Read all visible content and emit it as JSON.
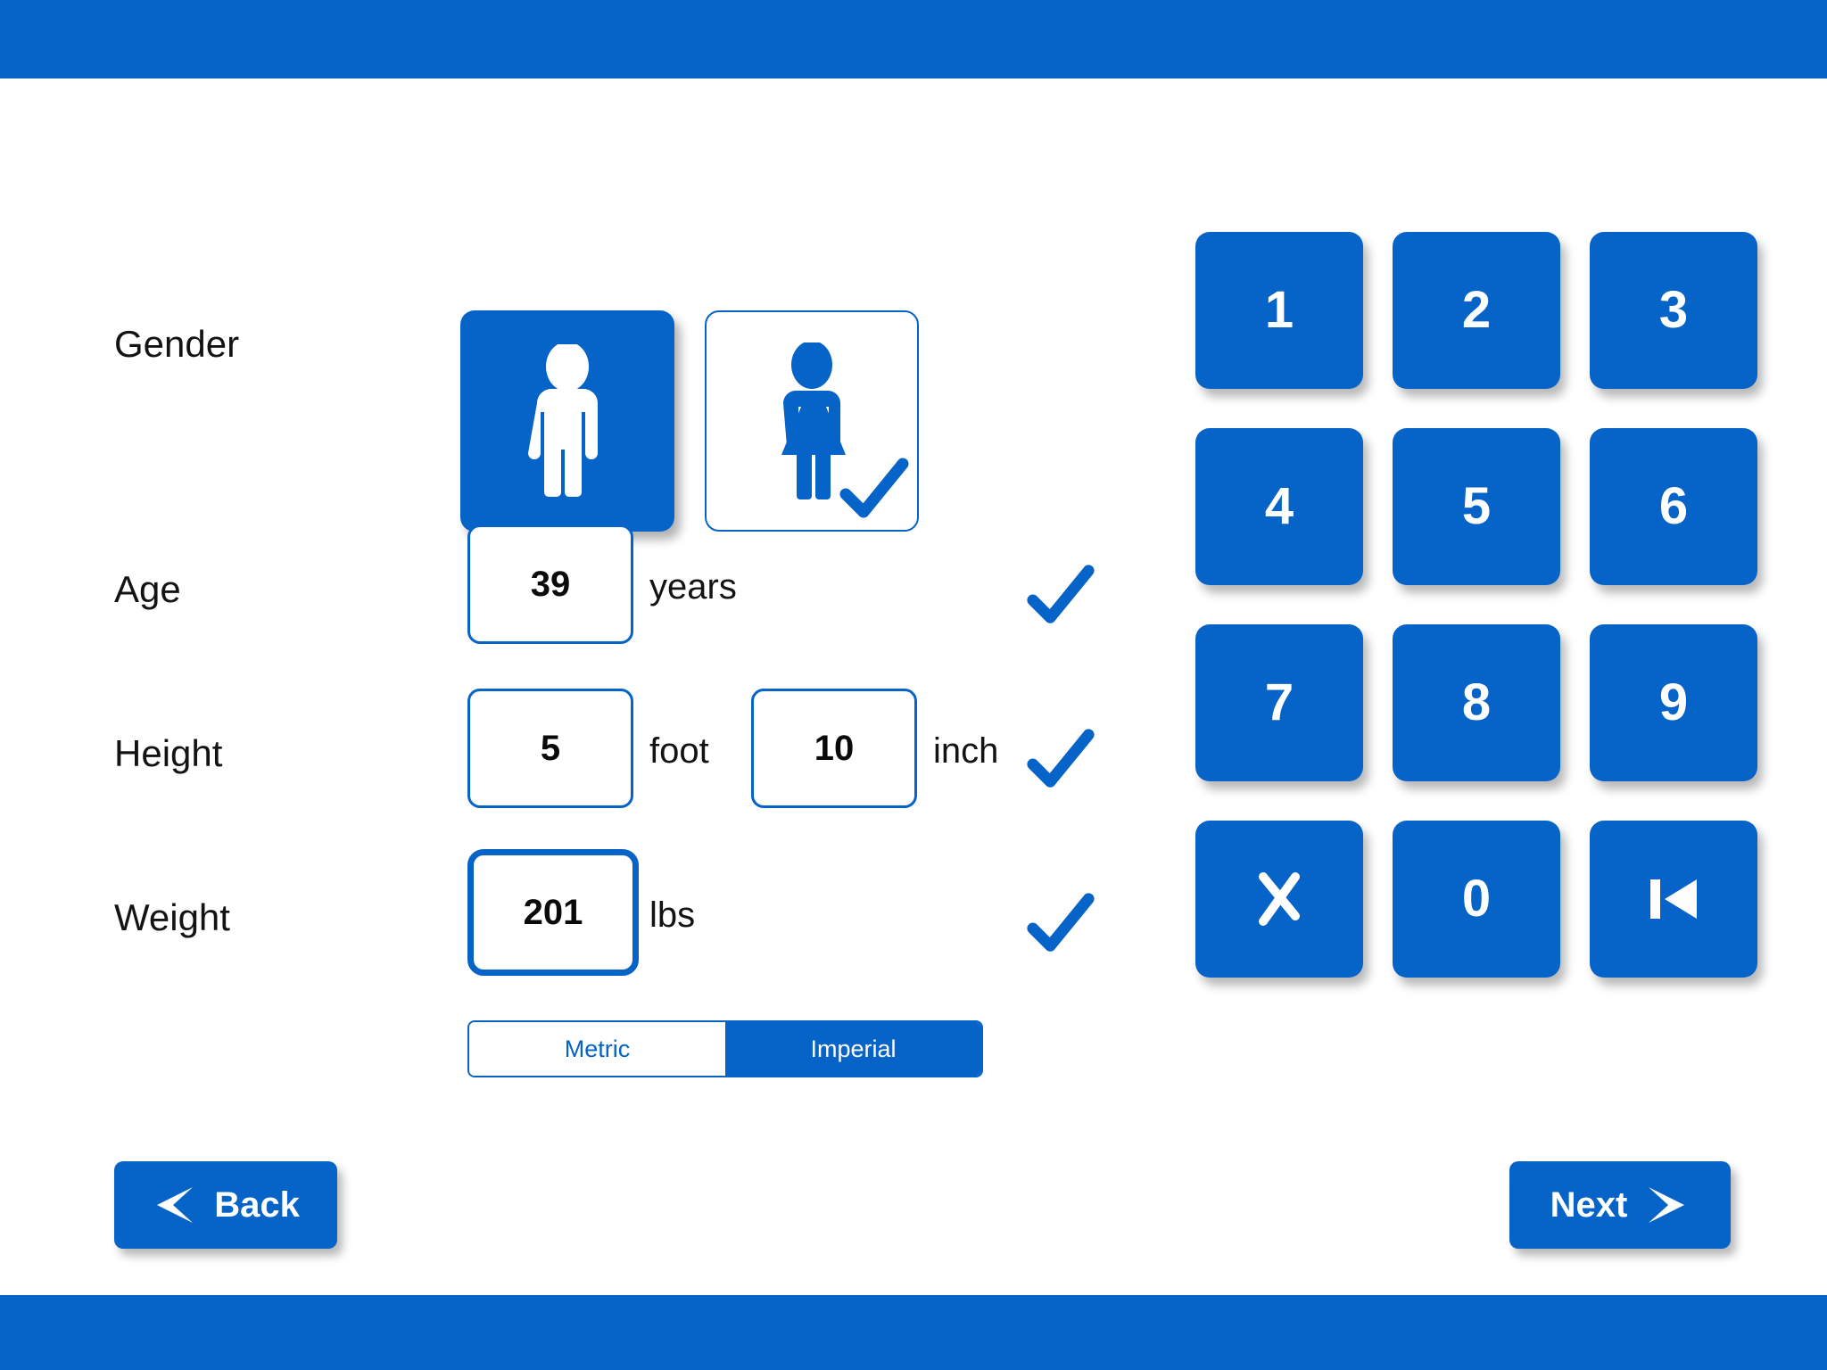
{
  "theme": {
    "brand_blue": "#0663C7",
    "white": "#FFFFFF",
    "text_dark": "#131313"
  },
  "chrome": {
    "top_bar_name": "top-bar",
    "bottom_bar_name": "bottom-bar"
  },
  "form": {
    "gender": {
      "label": "Gender",
      "male_icon": "male-figure-icon",
      "female_icon": "female-figure-icon",
      "selected": "female",
      "check_icon": "checkmark-icon"
    },
    "age": {
      "label": "Age",
      "value": "39",
      "unit": "years",
      "placeholder": "",
      "check_icon": "checkmark-icon"
    },
    "height": {
      "label": "Height",
      "feet_value": "5",
      "feet_unit": "foot",
      "inch_value": "10",
      "inch_unit": "inch",
      "check_icon": "checkmark-icon"
    },
    "weight": {
      "label": "Weight",
      "value": "201",
      "unit": "lbs",
      "check_icon": "checkmark-icon"
    },
    "unit_toggle": {
      "metric_label": "Metric",
      "imperial_label": "Imperial",
      "selected": "Imperial"
    }
  },
  "keypad": {
    "keys": [
      {
        "label": "1",
        "name": "key-1",
        "icon": null
      },
      {
        "label": "2",
        "name": "key-2",
        "icon": null
      },
      {
        "label": "3",
        "name": "key-3",
        "icon": null
      },
      {
        "label": "4",
        "name": "key-4",
        "icon": null
      },
      {
        "label": "5",
        "name": "key-5",
        "icon": null
      },
      {
        "label": "6",
        "name": "key-6",
        "icon": null
      },
      {
        "label": "7",
        "name": "key-7",
        "icon": null
      },
      {
        "label": "8",
        "name": "key-8",
        "icon": null
      },
      {
        "label": "9",
        "name": "key-9",
        "icon": null
      },
      {
        "label": "X",
        "name": "key-clear",
        "icon": "clear-x-icon"
      },
      {
        "label": "0",
        "name": "key-0",
        "icon": null
      },
      {
        "label": "",
        "name": "key-backspace",
        "icon": "skip-back-icon"
      }
    ]
  },
  "nav": {
    "back_label": "Back",
    "back_icon": "chevron-left-icon",
    "next_label": "Next",
    "next_icon": "chevron-right-icon"
  }
}
